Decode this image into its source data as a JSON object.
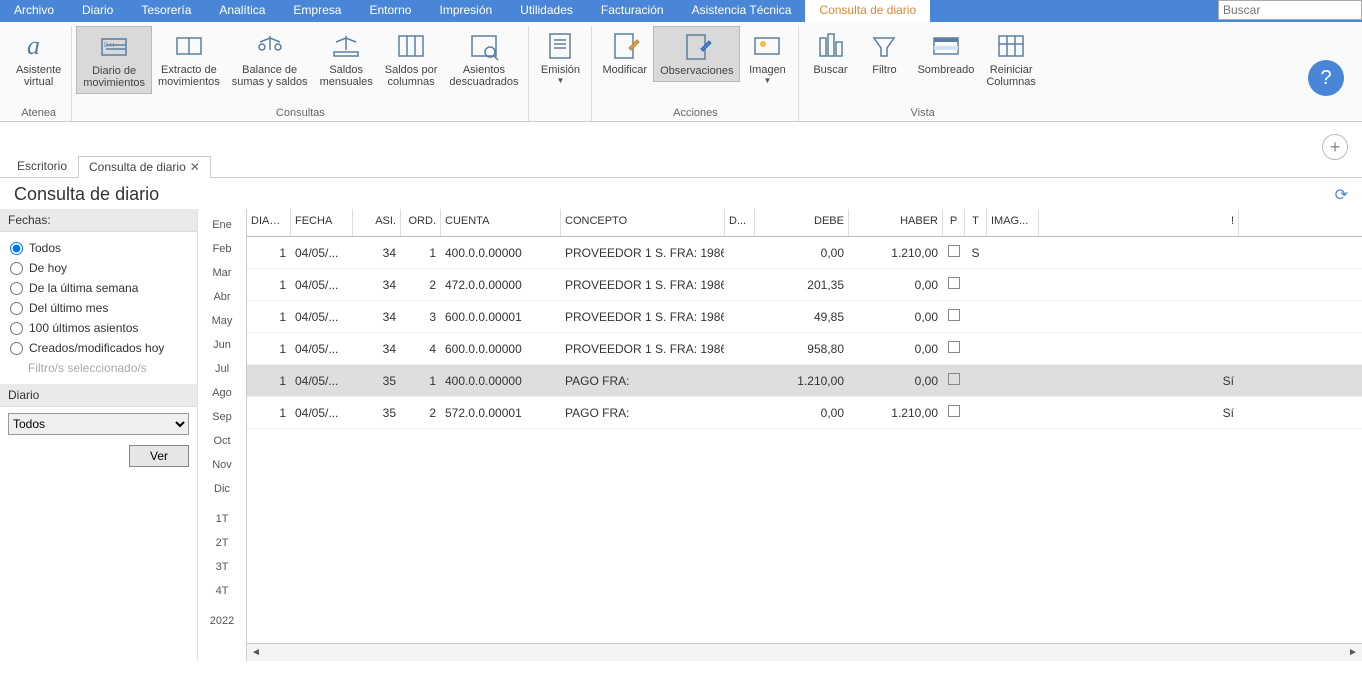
{
  "menubar": [
    "Archivo",
    "Diario",
    "Tesorería",
    "Analítica",
    "Empresa",
    "Entorno",
    "Impresión",
    "Utilidades",
    "Facturación",
    "Asistencia Técnica",
    "Consulta de diario"
  ],
  "menubar_active_index": 10,
  "search_placeholder": "Buscar",
  "ribbon": {
    "groups": [
      {
        "label": "Atenea",
        "buttons": [
          {
            "name": "asistente-virtual",
            "label": "Asistente\nvirtual"
          }
        ]
      },
      {
        "label": "Consultas",
        "buttons": [
          {
            "name": "diario-movimientos",
            "label": "Diario de\nmovimientos",
            "active": true
          },
          {
            "name": "extracto-movimientos",
            "label": "Extracto de\nmovimientos"
          },
          {
            "name": "balance-sumas-saldos",
            "label": "Balance de\nsumas y saldos"
          },
          {
            "name": "saldos-mensuales",
            "label": "Saldos\nmensuales"
          },
          {
            "name": "saldos-columnas",
            "label": "Saldos por\ncolumnas"
          },
          {
            "name": "asientos-descuadrados",
            "label": "Asientos\ndescuadrados"
          }
        ]
      },
      {
        "label": "",
        "buttons": [
          {
            "name": "emision",
            "label": "Emisión",
            "drop": true
          }
        ]
      },
      {
        "label": "Acciones",
        "buttons": [
          {
            "name": "modificar",
            "label": "Modificar"
          },
          {
            "name": "observaciones",
            "label": "Observaciones",
            "active": true
          },
          {
            "name": "imagen",
            "label": "Imagen",
            "drop": true
          }
        ]
      },
      {
        "label": "Vista",
        "buttons": [
          {
            "name": "buscar",
            "label": "Buscar"
          },
          {
            "name": "filtro",
            "label": "Filtro"
          },
          {
            "name": "sombreado",
            "label": "Sombreado"
          },
          {
            "name": "reiniciar-columnas",
            "label": "Reiniciar\nColumnas"
          }
        ]
      }
    ]
  },
  "tabs": [
    {
      "label": "Escritorio",
      "active": false
    },
    {
      "label": "Consulta de diario",
      "active": true,
      "closable": true
    }
  ],
  "page_title": "Consulta de diario",
  "sidebar": {
    "fechas_label": "Fechas:",
    "radios": [
      {
        "label": "Todos",
        "checked": true
      },
      {
        "label": "De hoy"
      },
      {
        "label": "De la última semana"
      },
      {
        "label": "Del último mes"
      },
      {
        "label": "100 últimos asientos"
      },
      {
        "label": "Creados/modificados hoy"
      }
    ],
    "filter_disabled": "Filtro/s seleccionado/s",
    "diario_label": "Diario",
    "diario_value": "Todos",
    "ver_label": "Ver"
  },
  "months": [
    "Ene",
    "Feb",
    "Mar",
    "Abr",
    "May",
    "Jun",
    "Jul",
    "Ago",
    "Sep",
    "Oct",
    "Nov",
    "Dic",
    "",
    "1T",
    "2T",
    "3T",
    "4T",
    "",
    "2022"
  ],
  "grid": {
    "headers": [
      "DIAR...",
      "FECHA",
      "ASI.",
      "ORD.",
      "CUENTA",
      "CONCEPTO",
      "D...",
      "DEBE",
      "HABER",
      "P",
      "T",
      "IMAG...",
      "!"
    ],
    "rows": [
      {
        "diar": "1",
        "fecha": "04/05/...",
        "asi": "34",
        "ord": "1",
        "cuenta": "400.0.0.00000",
        "concepto": "PROVEEDOR 1 S. FRA:  1986",
        "d": "",
        "debe": "0,00",
        "haber": "1.210,00",
        "t": "S",
        "excl": ""
      },
      {
        "diar": "1",
        "fecha": "04/05/...",
        "asi": "34",
        "ord": "2",
        "cuenta": "472.0.0.00000",
        "concepto": "PROVEEDOR 1 S. FRA:  1986",
        "d": "",
        "debe": "201,35",
        "haber": "0,00",
        "t": "",
        "excl": ""
      },
      {
        "diar": "1",
        "fecha": "04/05/...",
        "asi": "34",
        "ord": "3",
        "cuenta": "600.0.0.00001",
        "concepto": "PROVEEDOR 1 S. FRA:  1986",
        "d": "",
        "debe": "49,85",
        "haber": "0,00",
        "t": "",
        "excl": ""
      },
      {
        "diar": "1",
        "fecha": "04/05/...",
        "asi": "34",
        "ord": "4",
        "cuenta": "600.0.0.00000",
        "concepto": "PROVEEDOR 1 S. FRA:  1986",
        "d": "",
        "debe": "958,80",
        "haber": "0,00",
        "t": "",
        "excl": ""
      },
      {
        "diar": "1",
        "fecha": "04/05/...",
        "asi": "35",
        "ord": "1",
        "cuenta": "400.0.0.00000",
        "concepto": "PAGO FRA:",
        "d": "",
        "debe": "1.210,00",
        "haber": "0,00",
        "t": "",
        "excl": "Sí",
        "selected": true
      },
      {
        "diar": "1",
        "fecha": "04/05/...",
        "asi": "35",
        "ord": "2",
        "cuenta": "572.0.0.00001",
        "concepto": "PAGO FRA:",
        "d": "",
        "debe": "0,00",
        "haber": "1.210,00",
        "t": "",
        "excl": "Sí"
      }
    ]
  }
}
